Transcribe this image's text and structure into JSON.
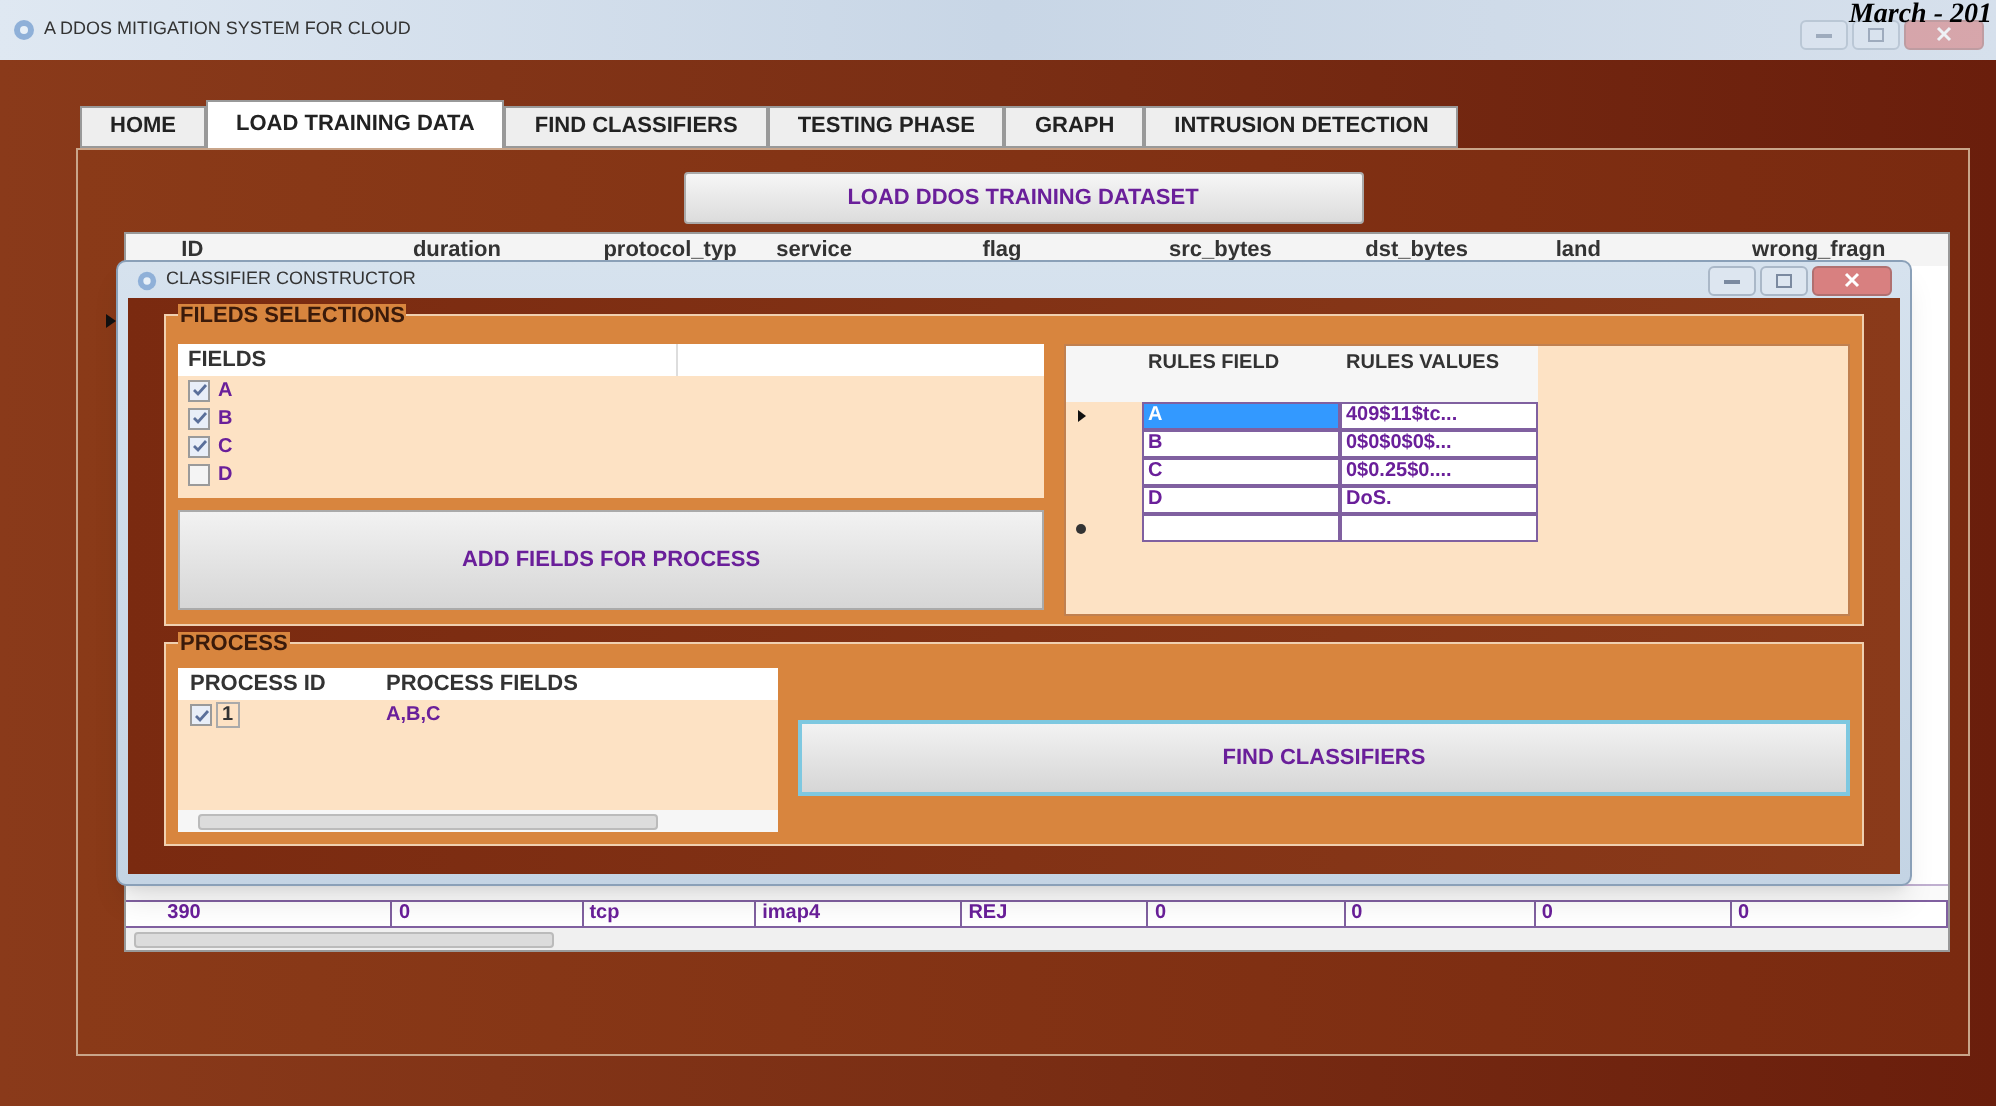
{
  "window": {
    "title": "A DDOS MITIGATION SYSTEM FOR CLOUD"
  },
  "header_note": "March - 201",
  "tabs": [
    {
      "label": "HOME",
      "selected": false
    },
    {
      "label": "LOAD TRAINING DATA",
      "selected": true
    },
    {
      "label": "FIND CLASSIFIERS",
      "selected": false
    },
    {
      "label": "TESTING PHASE",
      "selected": false
    },
    {
      "label": "GRAPH",
      "selected": false
    },
    {
      "label": "INTRUSION DETECTION",
      "selected": false
    }
  ],
  "load_button": "LOAD DDOS TRAINING DATASET",
  "dataset_grid": {
    "columns": [
      "ID",
      "duration",
      "protocol_typ",
      "service",
      "flag",
      "src_bytes",
      "dst_bytes",
      "land",
      "wrong_fragn"
    ],
    "rows": [
      [
        "390",
        "0",
        "tcp",
        "imap4",
        "REJ",
        "0",
        "0",
        "0",
        "0"
      ]
    ]
  },
  "dialog": {
    "title": "CLASSIFIER CONSTRUCTOR",
    "fields_group": {
      "title": "FILEDS SELECTIONS",
      "list_header": "FIELDS",
      "fields": [
        {
          "label": "A",
          "checked": true
        },
        {
          "label": "B",
          "checked": true
        },
        {
          "label": "C",
          "checked": true
        },
        {
          "label": "D",
          "checked": false
        }
      ],
      "add_button": "ADD FIELDS FOR PROCESS",
      "rules_grid": {
        "columns": [
          "RULES FIELD",
          "RULES VALUES"
        ],
        "rows": [
          {
            "field": "A",
            "value": "409$11$tc...",
            "selected": true
          },
          {
            "field": "B",
            "value": "0$0$0$0$...",
            "selected": false
          },
          {
            "field": "C",
            "value": "0$0.25$0....",
            "selected": false
          },
          {
            "field": "D",
            "value": "DoS.",
            "selected": false
          }
        ]
      }
    },
    "process_group": {
      "title": "PROCESS",
      "columns": [
        "PROCESS ID",
        "PROCESS FIELDS"
      ],
      "rows": [
        {
          "id": "1",
          "fields": "A,B,C",
          "checked": true
        }
      ],
      "find_button": "FIND CLASSIFIERS"
    }
  }
}
